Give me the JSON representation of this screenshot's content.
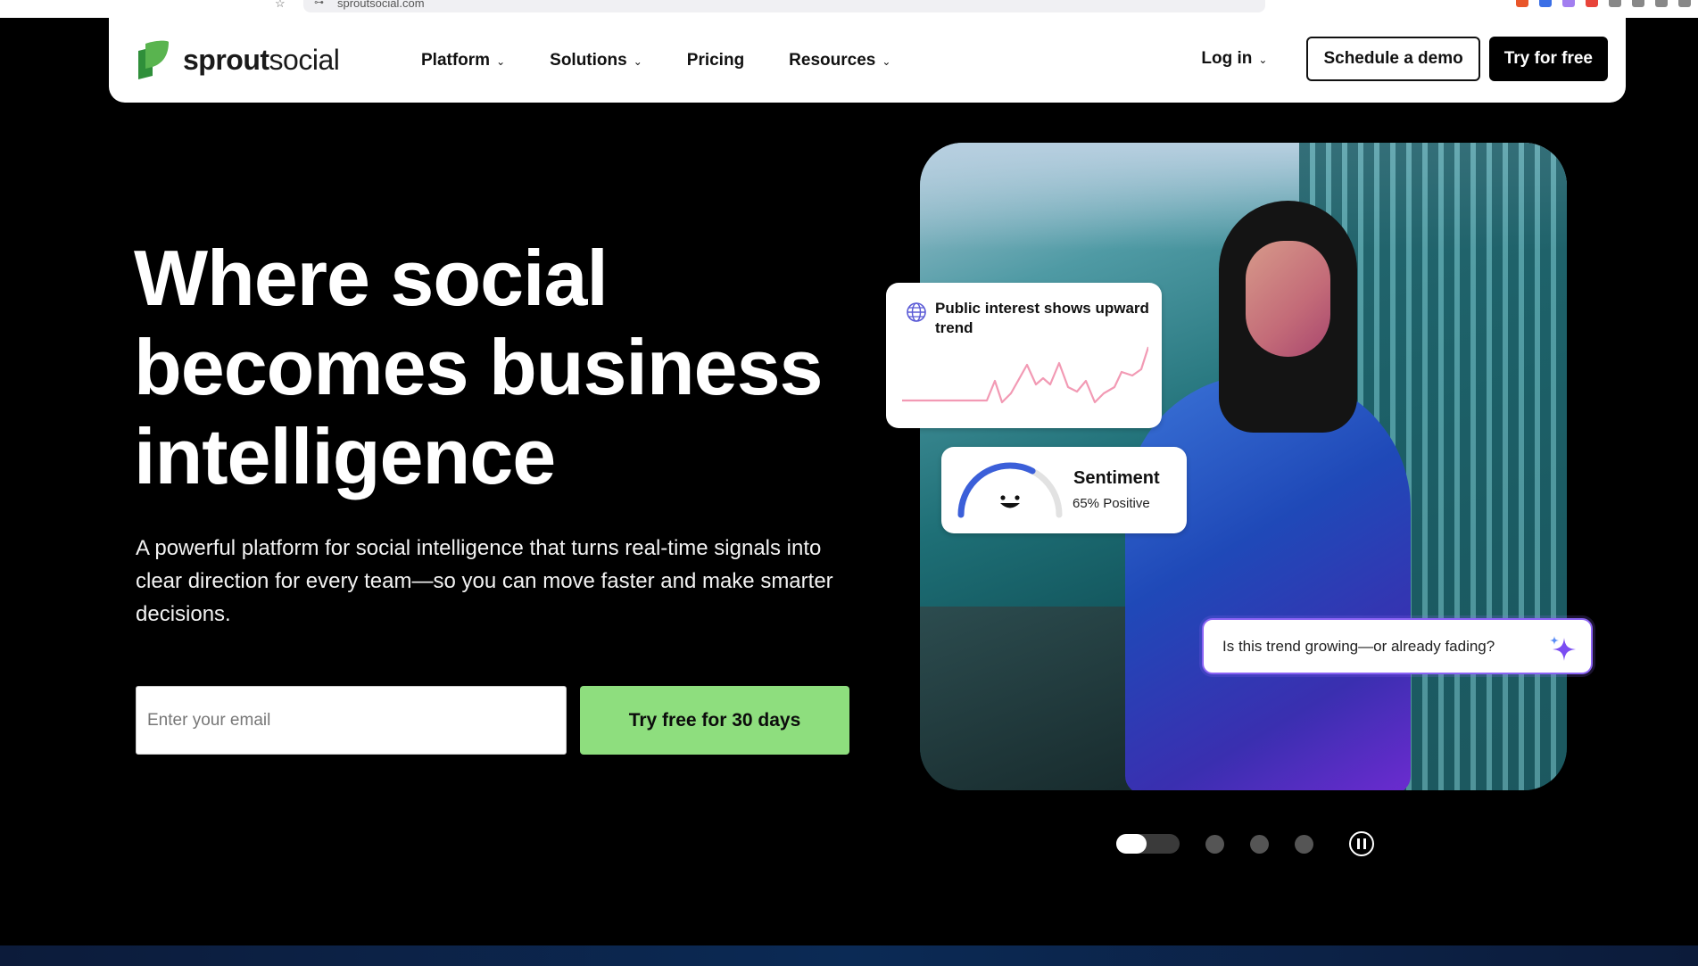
{
  "browser": {
    "url": "sproutsocial.com"
  },
  "nav": {
    "logo_bold": "sprout",
    "logo_light": "social",
    "items": [
      {
        "label": "Platform",
        "has_dropdown": true
      },
      {
        "label": "Solutions",
        "has_dropdown": true
      },
      {
        "label": "Pricing",
        "has_dropdown": false
      },
      {
        "label": "Resources",
        "has_dropdown": true
      }
    ],
    "login_label": "Log in",
    "demo_label": "Schedule a demo",
    "try_label": "Try for free",
    "chevron": "⌄"
  },
  "hero": {
    "title": "Where social becomes business intelligence",
    "subtitle": "A powerful platform for social intelligence that turns real-time signals into clear direction for every team—so you can move faster and make smarter decisions.",
    "email_placeholder": "Enter your email",
    "cta_label": "Try free for 30 days"
  },
  "cards": {
    "trend_text": "Public interest shows upward trend",
    "sentiment_title": "Sentiment",
    "sentiment_value": "65% Positive",
    "sentiment_percent": 65,
    "ask_text": "Is this trend growing—or already fading?"
  },
  "carousel": {
    "slides": 4,
    "active_index": 0
  },
  "colors": {
    "brand_green": "#59b44f",
    "cta_green": "#8ede7e",
    "accent_purple": "#8b63f5",
    "trend_pink": "#f29ab4"
  },
  "icons": [
    "sprout-leaf-logo",
    "chevron-down-icon",
    "globe-icon",
    "smile-icon",
    "sparkle-icon",
    "pause-icon"
  ]
}
